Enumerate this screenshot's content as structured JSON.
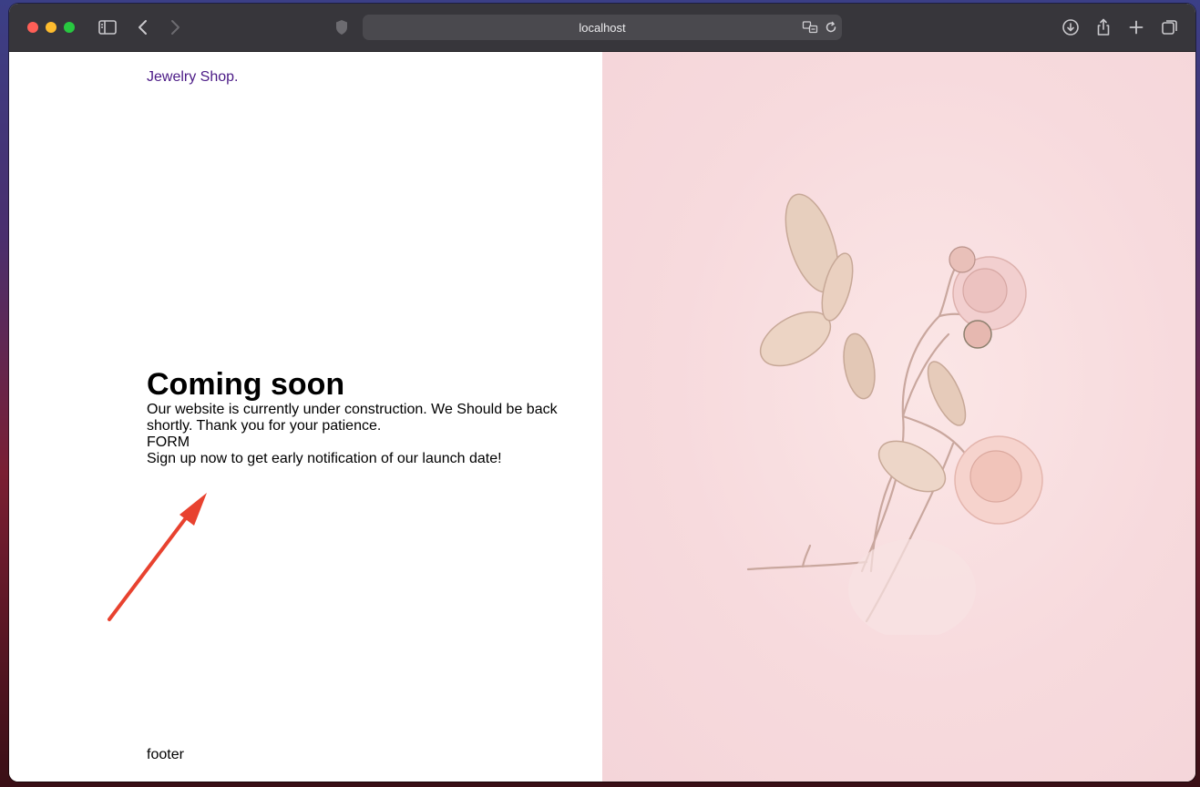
{
  "browser": {
    "url": "localhost"
  },
  "page": {
    "brand": "Jewelry Shop.",
    "heading": "Coming soon",
    "message": "Our website is currently under construction. We Should be back shortly. Thank you for your patience.",
    "form_placeholder": "FORM",
    "signup_text": "Sign up now to get early notification of our launch date!",
    "footer": "footer"
  },
  "colors": {
    "brand_text": "#4b1a86",
    "annotation_arrow": "#e8422f",
    "hero_background": "#f7dadd"
  },
  "icons": {
    "toolbar": [
      "sidebar-icon",
      "back-icon",
      "forward-icon",
      "shield-icon",
      "translate-icon",
      "reload-icon",
      "download-icon",
      "share-icon",
      "new-tab-icon",
      "tabs-overview-icon"
    ]
  }
}
